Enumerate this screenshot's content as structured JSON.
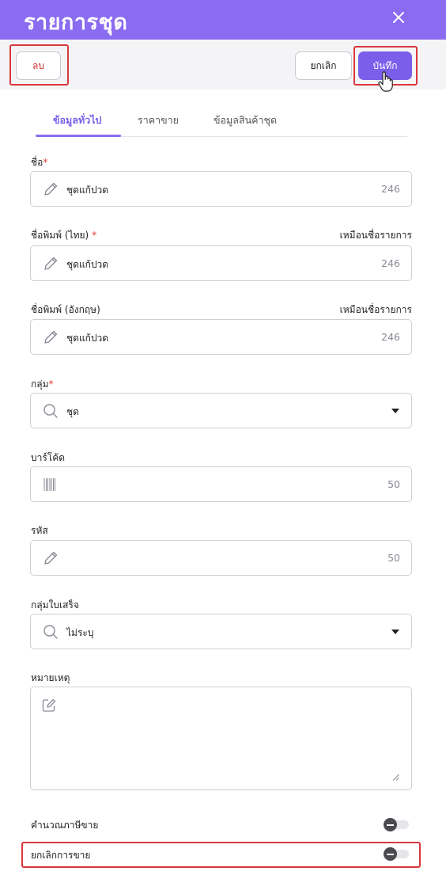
{
  "header": {
    "title": "รายการชุด",
    "close_icon": "close-icon"
  },
  "toolbar": {
    "delete_label": "ลบ",
    "cancel_label": "ยกเลิก",
    "save_label": "บันทึก"
  },
  "tabs": [
    {
      "label": "ข้อมูลทั่วไป",
      "active": true
    },
    {
      "label": "ราคาขาย",
      "active": false
    },
    {
      "label": "ข้อมูลสินค้าชุด",
      "active": false
    }
  ],
  "form": {
    "name": {
      "label": "ชื่อ",
      "required_mark": "*",
      "value": "ชุดแก้ปวด",
      "counter": "246",
      "icon": "pencil-icon"
    },
    "print_name_th": {
      "label": "ชื่อพิมพ์ (ไทย)",
      "required_mark": "*",
      "side_label": "เหมือนชื่อรายการ",
      "value": "ชุดแก้ปวด",
      "counter": "246",
      "icon": "pencil-icon"
    },
    "print_name_en": {
      "label": "ชื่อพิมพ์ (อังกฤษ)",
      "side_label": "เหมือนชื่อรายการ",
      "value": "ชุดแก้ปวด",
      "counter": "246",
      "icon": "pencil-icon"
    },
    "group": {
      "label": "กลุ่ม",
      "required_mark": "*",
      "value": "ชุด",
      "icon": "search-icon"
    },
    "barcode": {
      "label": "บาร์โค้ด",
      "value": "",
      "counter": "50",
      "icon": "barcode-icon"
    },
    "code": {
      "label": "รหัส",
      "value": "",
      "counter": "50",
      "icon": "pencil-icon"
    },
    "receipt_group": {
      "label": "กลุ่มใบเสร็จ",
      "value": "ไม่ระบุ",
      "icon": "search-icon"
    },
    "note": {
      "label": "หมายเหตุ",
      "value": "",
      "icon": "edit-note-icon"
    }
  },
  "toggles": {
    "calc_sales_tax": {
      "label": "คำนวณภาษีขาย",
      "on": false
    },
    "cancel_sale": {
      "label": "ยกเลิกการขาย",
      "on": false
    }
  },
  "colors": {
    "header": "#8b6cf0",
    "accent": "#7b5fea",
    "highlight": "#d9383c",
    "delete_text": "#d32f2f"
  }
}
